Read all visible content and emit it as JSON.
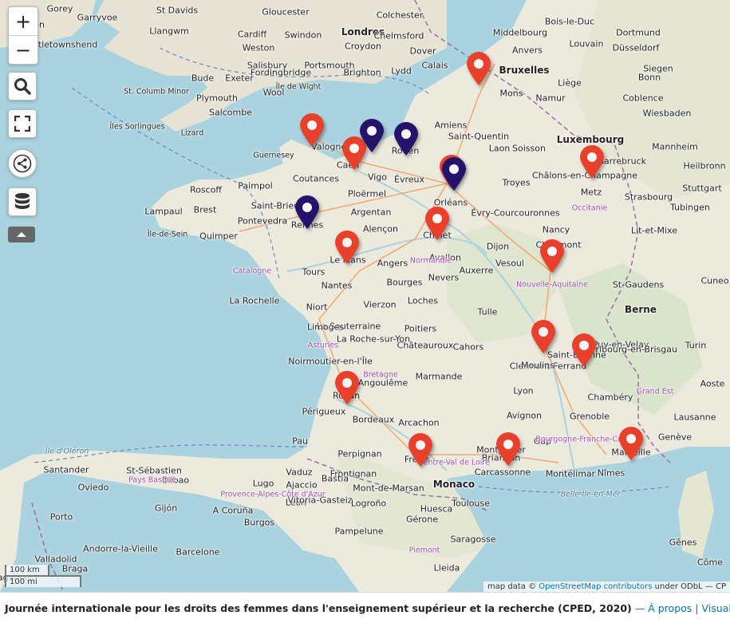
{
  "map": {
    "controls": {
      "zoom_in": "+",
      "zoom_out": "−",
      "search_icon": "search-icon",
      "fullscreen_icon": "fullscreen-icon",
      "share_icon": "share-icon",
      "data_icon": "database-icon",
      "toggle_icon": "caret-up-icon"
    },
    "colors": {
      "red_marker": "#e8402a",
      "blue_marker": "#24126b",
      "water": "#aad3df",
      "land": "#e9e6df",
      "link": "#0078a8"
    },
    "scale": {
      "km": "100 km",
      "mi": "100 mi"
    },
    "attribution": {
      "prefix": "map data ©",
      "link": "OpenStreetMap contributors",
      "suffix": "under ODbL — CP"
    },
    "places": [
      {
        "t": "Gorey",
        "c": ""
      },
      {
        "t": "St Davids",
        "c": ""
      },
      {
        "t": "Garryvoe",
        "c": ""
      },
      {
        "t": "Bandon",
        "c": ""
      },
      {
        "t": "Castletownshend",
        "c": ""
      },
      {
        "t": "Gloucester",
        "c": ""
      },
      {
        "t": "Colchester",
        "c": ""
      },
      {
        "t": "Llangwm",
        "c": ""
      },
      {
        "t": "Cardiff",
        "c": ""
      },
      {
        "t": "Swindon",
        "c": ""
      },
      {
        "t": "Londres",
        "c": "cap"
      },
      {
        "t": "Chelmsford",
        "c": ""
      },
      {
        "t": "Weston",
        "c": ""
      },
      {
        "t": "Croydon",
        "c": ""
      },
      {
        "t": "Dover",
        "c": ""
      },
      {
        "t": "Salisbury",
        "c": ""
      },
      {
        "t": "Portsmouth",
        "c": ""
      },
      {
        "t": "Fordingbridge",
        "c": ""
      },
      {
        "t": "Brighton",
        "c": ""
      },
      {
        "t": "Lydd",
        "c": ""
      },
      {
        "t": "Bude",
        "c": ""
      },
      {
        "t": "Exeter",
        "c": ""
      },
      {
        "t": "Île de Wight",
        "c": "small"
      },
      {
        "t": "St. Columb Minor",
        "c": "small"
      },
      {
        "t": "Plymouth",
        "c": ""
      },
      {
        "t": "Wool",
        "c": ""
      },
      {
        "t": "Salcombe",
        "c": ""
      },
      {
        "t": "Îles Sorlingues",
        "c": "small"
      },
      {
        "t": "Lizard",
        "c": "small"
      },
      {
        "t": "Guernesey",
        "c": "small"
      },
      {
        "t": "Middelbourg",
        "c": ""
      },
      {
        "t": "Louvain",
        "c": ""
      },
      {
        "t": "Calais",
        "c": ""
      },
      {
        "t": "Bruxelles",
        "c": "cap"
      },
      {
        "t": "Anvers",
        "c": ""
      },
      {
        "t": "Bois-le-Duc",
        "c": ""
      },
      {
        "t": "Düsseldorf",
        "c": ""
      },
      {
        "t": "Dortmund",
        "c": ""
      },
      {
        "t": "Siegen",
        "c": ""
      },
      {
        "t": "Bonn",
        "c": ""
      },
      {
        "t": "Liège",
        "c": ""
      },
      {
        "t": "Mons",
        "c": ""
      },
      {
        "t": "Namur",
        "c": ""
      },
      {
        "t": "Coblence",
        "c": ""
      },
      {
        "t": "Wiesbaden",
        "c": ""
      },
      {
        "t": "Luxembourg",
        "c": "cap"
      },
      {
        "t": "Mannheim",
        "c": ""
      },
      {
        "t": "Heilbronn",
        "c": ""
      },
      {
        "t": "Sarrebruck",
        "c": ""
      },
      {
        "t": "Stuttgart",
        "c": ""
      },
      {
        "t": "Tubingen",
        "c": ""
      },
      {
        "t": "Strasbourg",
        "c": ""
      },
      {
        "t": "Amiens",
        "c": ""
      },
      {
        "t": "Laon",
        "c": ""
      },
      {
        "t": "Soisson",
        "c": ""
      },
      {
        "t": "Saint-Quentin",
        "c": ""
      },
      {
        "t": "Rouen",
        "c": ""
      },
      {
        "t": "Évreux",
        "c": ""
      },
      {
        "t": "Caen",
        "c": ""
      },
      {
        "t": "Valognes",
        "c": ""
      },
      {
        "t": "Coutances",
        "c": ""
      },
      {
        "t": "Paimpol",
        "c": ""
      },
      {
        "t": "Roscoff",
        "c": ""
      },
      {
        "t": "Brest",
        "c": ""
      },
      {
        "t": "Lampaul",
        "c": ""
      },
      {
        "t": "Quimper",
        "c": ""
      },
      {
        "t": "Île-de-Sein",
        "c": "small"
      },
      {
        "t": "Saint-Brieuc",
        "c": ""
      },
      {
        "t": "Rennes",
        "c": ""
      },
      {
        "t": "Ploërmel",
        "c": ""
      },
      {
        "t": "Argentan",
        "c": ""
      },
      {
        "t": "Alençon",
        "c": ""
      },
      {
        "t": "Le Mans",
        "c": ""
      },
      {
        "t": "Angers",
        "c": ""
      },
      {
        "t": "Tours",
        "c": ""
      },
      {
        "t": "Nantes",
        "c": ""
      },
      {
        "t": "Cholet",
        "c": ""
      },
      {
        "t": "Orléans",
        "c": ""
      },
      {
        "t": "Évry-Courcouronnes",
        "c": ""
      },
      {
        "t": "Troyes",
        "c": ""
      },
      {
        "t": "Châlons-en-Champagne",
        "c": ""
      },
      {
        "t": "Metz",
        "c": ""
      },
      {
        "t": "Nancy",
        "c": ""
      },
      {
        "t": "Chaumont",
        "c": ""
      },
      {
        "t": "Dijon",
        "c": ""
      },
      {
        "t": "Vesoul",
        "c": ""
      },
      {
        "t": "Auxerre",
        "c": ""
      },
      {
        "t": "Avallon",
        "c": ""
      },
      {
        "t": "Nevers",
        "c": ""
      },
      {
        "t": "Bourges",
        "c": ""
      },
      {
        "t": "Vierzon",
        "c": ""
      },
      {
        "t": "Loches",
        "c": ""
      },
      {
        "t": "Poitiers",
        "c": ""
      },
      {
        "t": "Châteauroux",
        "c": ""
      },
      {
        "t": "La Souterraine",
        "c": ""
      },
      {
        "t": "Limoges",
        "c": ""
      },
      {
        "t": "Niort",
        "c": ""
      },
      {
        "t": "La Rochelle",
        "c": ""
      },
      {
        "t": "La Roche-sur-Yon",
        "c": ""
      },
      {
        "t": "Noirmoutier-en-l'Île",
        "c": ""
      },
      {
        "t": "Angoulême",
        "c": ""
      },
      {
        "t": "Royan",
        "c": ""
      },
      {
        "t": "Périgueux",
        "c": ""
      },
      {
        "t": "Bordeaux",
        "c": ""
      },
      {
        "t": "Arcachon",
        "c": ""
      },
      {
        "t": "Marmande",
        "c": ""
      },
      {
        "t": "Cahors",
        "c": ""
      },
      {
        "t": "Tulle",
        "c": ""
      },
      {
        "t": "Clermont-Ferrand",
        "c": ""
      },
      {
        "t": "Moulins",
        "c": ""
      },
      {
        "t": "Lyon",
        "c": ""
      },
      {
        "t": "Saint-Étienne",
        "c": ""
      },
      {
        "t": "Le Puy-en-Velay",
        "c": ""
      },
      {
        "t": "Grenoble",
        "c": ""
      },
      {
        "t": "Chambéry",
        "c": ""
      },
      {
        "t": "Gap",
        "c": ""
      },
      {
        "t": "Briançon",
        "c": ""
      },
      {
        "t": "Avignon",
        "c": ""
      },
      {
        "t": "Montpellier",
        "c": ""
      },
      {
        "t": "Montélimar",
        "c": ""
      },
      {
        "t": "Nîmes",
        "c": ""
      },
      {
        "t": "Marseille",
        "c": ""
      },
      {
        "t": "Fréjus",
        "c": ""
      },
      {
        "t": "Monaco",
        "c": "cap"
      },
      {
        "t": "Toulouse",
        "c": ""
      },
      {
        "t": "Carcassonne",
        "c": ""
      },
      {
        "t": "Perpignan",
        "c": ""
      },
      {
        "t": "Frontignan",
        "c": ""
      },
      {
        "t": "Mont-de-Marsan",
        "c": ""
      },
      {
        "t": "Pau",
        "c": ""
      },
      {
        "t": "St-Gaudens",
        "c": ""
      },
      {
        "t": "Lit-et-Mixe",
        "c": ""
      },
      {
        "t": "Berne",
        "c": "cap"
      },
      {
        "t": "Fribourg-en-Brisgau",
        "c": ""
      },
      {
        "t": "Lausanne",
        "c": ""
      },
      {
        "t": "Aoste",
        "c": ""
      },
      {
        "t": "Genève",
        "c": ""
      },
      {
        "t": "Turin",
        "c": ""
      },
      {
        "t": "Cuneo",
        "c": ""
      },
      {
        "t": "Gênes",
        "c": ""
      },
      {
        "t": "Côme",
        "c": ""
      },
      {
        "t": "Vaduz",
        "c": ""
      },
      {
        "t": "Ajaccio",
        "c": ""
      },
      {
        "t": "Bastia",
        "c": ""
      },
      {
        "t": "St-Sébastien",
        "c": ""
      },
      {
        "t": "Bilbao",
        "c": ""
      },
      {
        "t": "Santander",
        "c": ""
      },
      {
        "t": "Oviedo",
        "c": ""
      },
      {
        "t": "Gijón",
        "c": ""
      },
      {
        "t": "A Coruña",
        "c": ""
      },
      {
        "t": "Lugo",
        "c": ""
      },
      {
        "t": "León",
        "c": ""
      },
      {
        "t": "Burgos",
        "c": ""
      },
      {
        "t": "Vitoria-Gasteiz",
        "c": ""
      },
      {
        "t": "Pampelune",
        "c": ""
      },
      {
        "t": "Logroño",
        "c": ""
      },
      {
        "t": "Huesca",
        "c": ""
      },
      {
        "t": "Saragosse",
        "c": ""
      },
      {
        "t": "Lleida",
        "c": ""
      },
      {
        "t": "Gérone",
        "c": ""
      },
      {
        "t": "Barcelone",
        "c": ""
      },
      {
        "t": "Andorre-la-Vieille",
        "c": ""
      },
      {
        "t": "Valladolid",
        "c": ""
      },
      {
        "t": "Bragance",
        "c": ""
      },
      {
        "t": "Braga",
        "c": ""
      },
      {
        "t": "Porto",
        "c": ""
      },
      {
        "t": "Vigo",
        "c": ""
      },
      {
        "t": "Pontevedra",
        "c": ""
      },
      {
        "t": "Normandie",
        "c": "region"
      },
      {
        "t": "Bretagne",
        "c": "region"
      },
      {
        "t": "Centre-Val de Loire",
        "c": "region"
      },
      {
        "t": "Nouvelle-Aquitaine",
        "c": "region"
      },
      {
        "t": "Occitanie",
        "c": "region"
      },
      {
        "t": "Bourgogne-Franche-Comté",
        "c": "region"
      },
      {
        "t": "Grand Est",
        "c": "region"
      },
      {
        "t": "Provence-Alpes-Côte d'Azur",
        "c": "region"
      },
      {
        "t": "Piemont",
        "c": "region"
      },
      {
        "t": "Pays Basque",
        "c": "region"
      },
      {
        "t": "Catalogne",
        "c": "region"
      },
      {
        "t": "Asturies",
        "c": "region"
      },
      {
        "t": "Belle-Île-en-Mer",
        "c": "sea"
      },
      {
        "t": "Île d'Oléron",
        "c": "sea"
      },
      {
        "t": "Îles d'Hyères",
        "c": "sea"
      },
      {
        "t": "A Pedra",
        "c": "small"
      }
    ],
    "markers": [
      {
        "name": "Calais-Lille",
        "color": "red"
      },
      {
        "name": "Saint-Lô",
        "color": "red"
      },
      {
        "name": "Caen",
        "color": "red"
      },
      {
        "name": "Le Havre",
        "color": "blue"
      },
      {
        "name": "Rouen",
        "color": "blue"
      },
      {
        "name": "Paris",
        "color": "red"
      },
      {
        "name": "Paris-2",
        "color": "blue"
      },
      {
        "name": "Rennes",
        "color": "blue"
      },
      {
        "name": "Angers",
        "color": "red"
      },
      {
        "name": "Orléans",
        "color": "red"
      },
      {
        "name": "Metz",
        "color": "red"
      },
      {
        "name": "Dijon",
        "color": "red"
      },
      {
        "name": "Lyon",
        "color": "red"
      },
      {
        "name": "Grenoble",
        "color": "red"
      },
      {
        "name": "Bordeaux",
        "color": "red"
      },
      {
        "name": "Toulouse",
        "color": "red"
      },
      {
        "name": "Montpellier",
        "color": "red"
      },
      {
        "name": "Nice",
        "color": "red"
      }
    ]
  },
  "footer": {
    "title": "Journée internationale pour les droits des femmes dans l'enseignement supérieur et la recherche (CPED, 2020)",
    "about": "— À propos",
    "separator": "|",
    "data_link": "Visualiser les données"
  }
}
